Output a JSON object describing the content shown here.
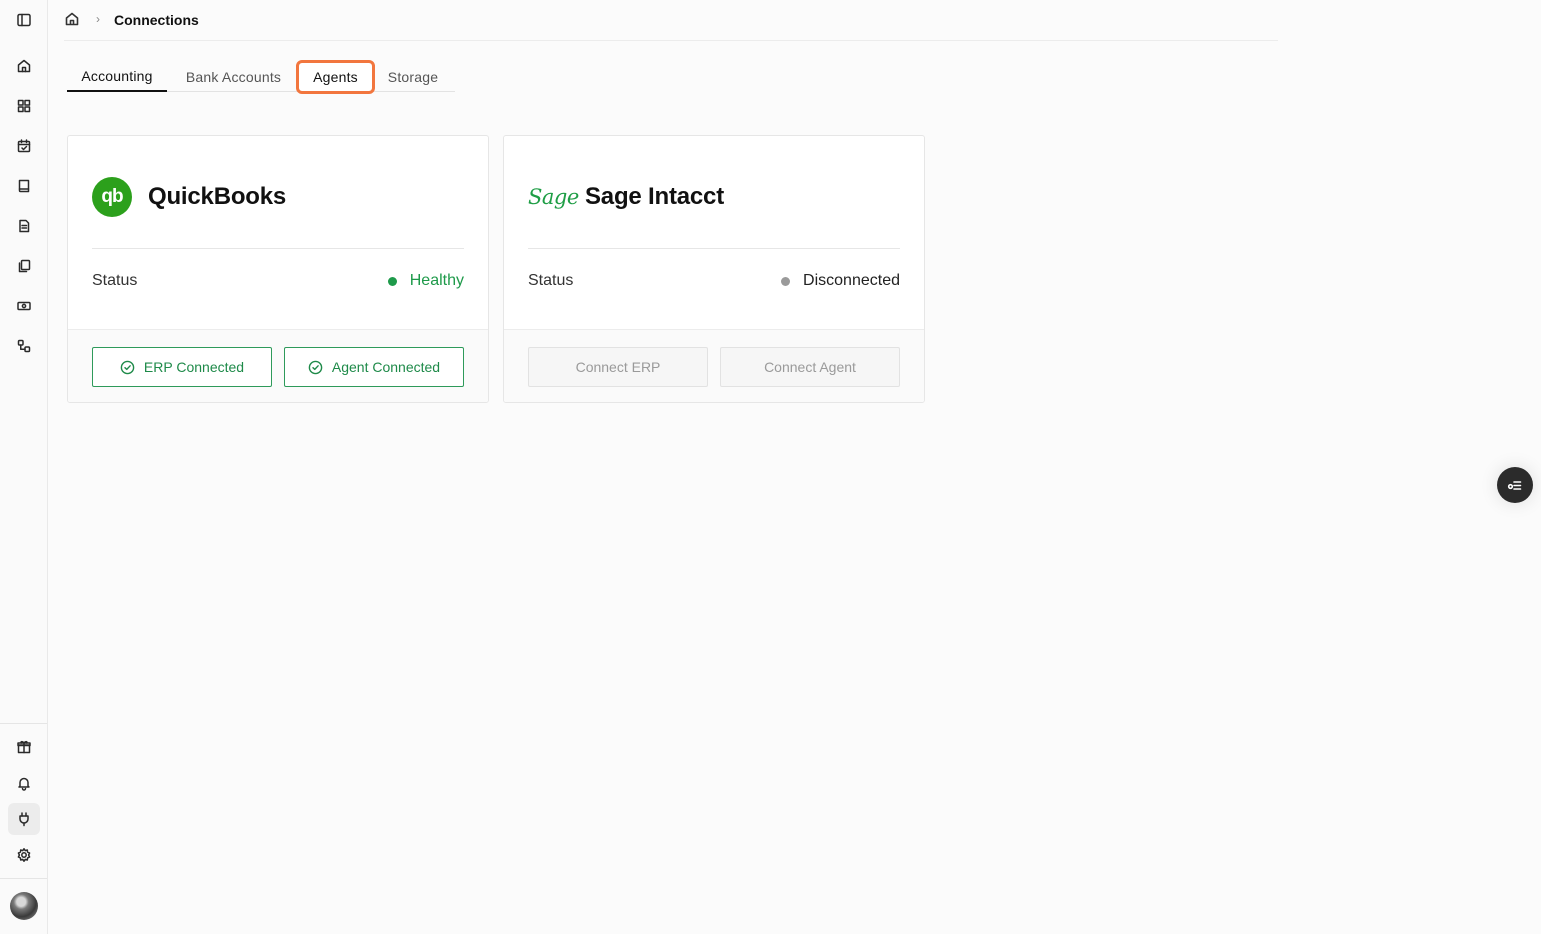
{
  "breadcrumb": {
    "current": "Connections",
    "separator": "›"
  },
  "tabs": [
    {
      "label": "Accounting",
      "active": true
    },
    {
      "label": "Bank Accounts",
      "active": false
    },
    {
      "label": "Agents",
      "active": false,
      "highlighted": true
    },
    {
      "label": "Storage",
      "active": false
    }
  ],
  "sidebar": {
    "top_icons": [
      "sidebar-toggle-icon",
      "home-icon",
      "dashboard-icon",
      "calendar-icon",
      "book-icon",
      "document-icon",
      "files-icon",
      "cash-icon",
      "workflow-icon"
    ],
    "bottom_icons": [
      "gift-icon",
      "bell-icon",
      "plug-icon",
      "gear-icon"
    ],
    "active_icon": "plug-icon"
  },
  "cards": [
    {
      "logo_text": "qb",
      "title": "QuickBooks",
      "status_label": "Status",
      "status_value": "Healthy",
      "status_color": "#1e9a4a",
      "buttons": [
        {
          "label": "ERP Connected",
          "state": "connected"
        },
        {
          "label": "Agent Connected",
          "state": "connected"
        }
      ]
    },
    {
      "logo_text": "Sage",
      "title": "Sage Intacct",
      "status_label": "Status",
      "status_value": "Disconnected",
      "status_color": "#9a9a9a",
      "buttons": [
        {
          "label": "Connect ERP",
          "state": "disabled"
        },
        {
          "label": "Connect Agent",
          "state": "disabled"
        }
      ]
    }
  ],
  "colors": {
    "accent_green": "#2ca01c",
    "highlight_orange": "#f2763e"
  }
}
